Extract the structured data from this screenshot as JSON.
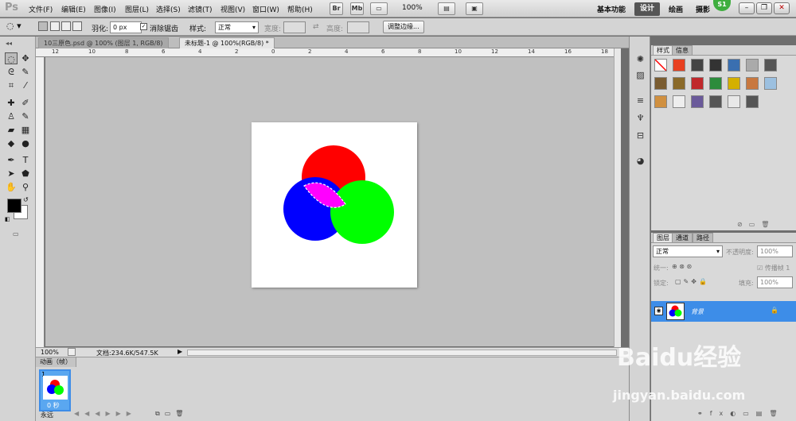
{
  "app": {
    "logo": "Ps"
  },
  "menus": [
    "文件(F)",
    "编辑(E)",
    "图像(I)",
    "图层(L)",
    "选择(S)",
    "滤镜(T)",
    "视图(V)",
    "窗口(W)",
    "帮助(H)"
  ],
  "menu_buttons": [
    "Br",
    "Mb"
  ],
  "zoom_select": "100%",
  "workspaces": {
    "items": [
      "基本功能",
      "设计",
      "绘画",
      "摄影"
    ],
    "active": "设计"
  },
  "badge": "S1",
  "options": {
    "feather_label": "羽化:",
    "feather_value": "0 px",
    "antialias_label": "消除锯齿",
    "style_label": "样式:",
    "style_value": "正常",
    "width_label": "宽度:",
    "height_label": "高度:",
    "refine_button": "调整边缘..."
  },
  "tabs": [
    "10三原色.psd @ 100% (图层 1, RGB/8)",
    "未标题-1 @ 100%(RGB/8) *"
  ],
  "ruler_numbers": [
    "12",
    "10",
    "8",
    "6",
    "4",
    "2",
    "0",
    "2",
    "4",
    "6",
    "8",
    "10",
    "12",
    "14",
    "16",
    "18"
  ],
  "status": {
    "zoom": "100%",
    "doc": "文档:234.6K/547.5K"
  },
  "animation": {
    "title": "动画（帧）",
    "frame_number": "1",
    "frame_time": "0 秒",
    "loop": "永远"
  },
  "styles_panel": {
    "tabs": [
      "样式",
      "信息"
    ]
  },
  "layers_panel": {
    "tabs": [
      "图层",
      "通道",
      "路径"
    ],
    "blend_mode": "正常",
    "opacity_label": "不透明度:",
    "opacity_value": "100%",
    "unify_label": "统一:",
    "propagate_label": "传播帧 1",
    "lock_label": "锁定:",
    "fill_label": "填充:",
    "fill_value": "100%",
    "layer_name": "背景"
  },
  "watermark": {
    "brand": "Baidu经验",
    "url": "jingyan.baidu.com"
  },
  "colors": {
    "accent": "#3d8de8",
    "red": "#ff0000",
    "blue": "#0000ff",
    "green": "#00ff00",
    "selection": "#ff00ff"
  }
}
